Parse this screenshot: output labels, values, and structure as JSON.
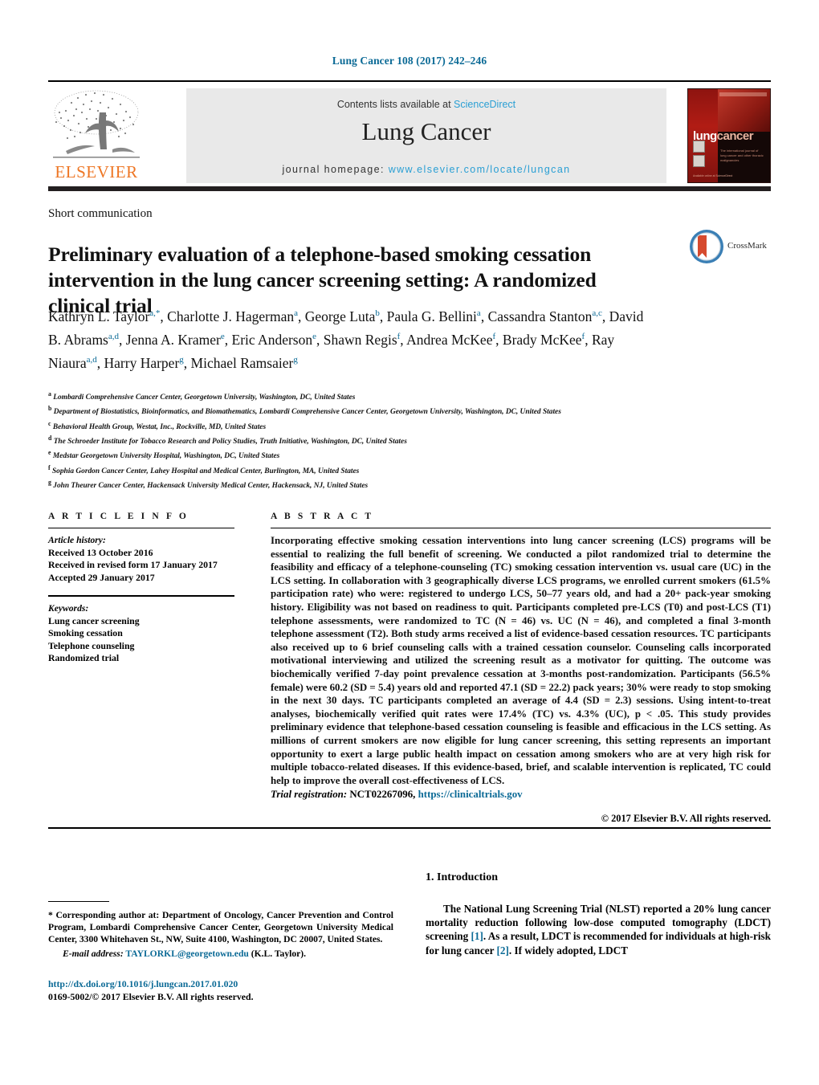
{
  "running_head": "Lung Cancer 108 (2017) 242–246",
  "masthead": {
    "contents_prefix": "Contents lists available at ",
    "contents_link": "ScienceDirect",
    "journal_title": "Lung Cancer",
    "homepage_prefix": "journal homepage: ",
    "homepage_url": "www.elsevier.com/locate/lungcan",
    "publisher_wordmark": "ELSEVIER",
    "cover": {
      "logo_part1": "lung",
      "logo_part2": "cancer",
      "subtitle": "The international journal of lung cancer and other thoracic malignancies",
      "footer": "Available online at ScienceDirect"
    },
    "colors": {
      "link": "#2a9fd4",
      "elsevier_orange": "#ee7624",
      "banner_gray": "#e9e9e9"
    }
  },
  "article": {
    "type": "Short communication",
    "title": "Preliminary evaluation of a telephone-based smoking cessation intervention in the lung cancer screening setting: A randomized clinical trial",
    "crossmark_label": "CrossMark",
    "authors_html": "Kathryn L. Taylor<sup>a,*</sup>, Charlotte J. Hagerman<sup>a</sup>, George Luta<sup>b</sup>, Paula G. Bellini<sup>a</sup>, Cassandra Stanton<sup>a,c</sup>, David B. Abrams<sup>a,d</sup>, Jenna A. Kramer<sup>e</sup>, Eric Anderson<sup>e</sup>, Shawn Regis<sup>f</sup>, Andrea McKee<sup>f</sup>, Brady McKee<sup>f</sup>, Ray Niaura<sup>a,d</sup>, Harry Harper<sup>g</sup>, Michael Ramsaier<sup>g</sup>",
    "affiliations": [
      {
        "marker": "a",
        "text": "Lombardi Comprehensive Cancer Center, Georgetown University, Washington, DC, United States"
      },
      {
        "marker": "b",
        "text": "Department of Biostatistics, Bioinformatics, and Biomathematics, Lombardi Comprehensive Cancer Center, Georgetown University, Washington, DC, United States"
      },
      {
        "marker": "c",
        "text": "Behavioral Health Group, Westat, Inc., Rockville, MD, United States"
      },
      {
        "marker": "d",
        "text": "The Schroeder Institute for Tobacco Research and Policy Studies, Truth Initiative, Washington, DC, United States"
      },
      {
        "marker": "e",
        "text": "Medstar Georgetown University Hospital, Washington, DC, United States"
      },
      {
        "marker": "f",
        "text": "Sophia Gordon Cancer Center, Lahey Hospital and Medical Center, Burlington, MA, United States"
      },
      {
        "marker": "g",
        "text": "John Theurer Cancer Center, Hackensack University Medical Center, Hackensack, NJ, United States"
      }
    ]
  },
  "article_info": {
    "heading": "A R T I C L E    I N F O",
    "history_label": "Article history:",
    "history": [
      "Received 13 October 2016",
      "Received in revised form 17 January 2017",
      "Accepted 29 January 2017"
    ],
    "keywords_label": "Keywords:",
    "keywords": [
      "Lung cancer screening",
      "Smoking cessation",
      "Telephone counseling",
      "Randomized trial"
    ]
  },
  "abstract": {
    "heading": "A B S T R A C T",
    "body": "Incorporating effective smoking cessation interventions into lung cancer screening (LCS) programs will be essential to realizing the full benefit of screening. We conducted a pilot randomized trial to determine the feasibility and efficacy of a telephone-counseling (TC) smoking cessation intervention vs. usual care (UC) in the LCS setting. In collaboration with 3 geographically diverse LCS programs, we enrolled current smokers (61.5% participation rate) who were: registered to undergo LCS, 50–77 years old, and had a 20+ pack-year smoking history. Eligibility was not based on readiness to quit. Participants completed pre-LCS (T0) and post-LCS (T1) telephone assessments, were randomized to TC (N = 46) vs. UC (N = 46), and completed a final 3-month telephone assessment (T2). Both study arms received a list of evidence-based cessation resources. TC participants also received up to 6 brief counseling calls with a trained cessation counselor. Counseling calls incorporated motivational interviewing and utilized the screening result as a motivator for quitting. The outcome was biochemically verified 7-day point prevalence cessation at 3-months post-randomization. Participants (56.5% female) were 60.2 (SD = 5.4) years old and reported 47.1 (SD = 22.2) pack years; 30% were ready to stop smoking in the next 30 days. TC participants completed an average of 4.4 (SD = 2.3) sessions. Using intent-to-treat analyses, biochemically verified quit rates were 17.4% (TC) vs. 4.3% (UC), p < .05. This study provides preliminary evidence that telephone-based cessation counseling is feasible and efficacious in the LCS setting. As millions of current smokers are now eligible for lung cancer screening, this setting represents an important opportunity to exert a large public health impact on cessation among smokers who are at very high risk for multiple tobacco-related diseases. If this evidence-based, brief, and scalable intervention is replicated, TC could help to improve the overall cost-effectiveness of LCS.",
    "trial_label": "Trial registration:",
    "trial_value": "NCT02267096,",
    "trial_link": "https://clinicaltrials.gov",
    "copyright": "© 2017 Elsevier B.V. All rights reserved."
  },
  "footnote": {
    "corresponding": "* Corresponding author at: Department of Oncology, Cancer Prevention and Control Program, Lombardi Comprehensive Cancer Center, Georgetown University Medical Center, 3300 Whitehaven St., NW, Suite 4100, Washington, DC 20007, United States.",
    "email_label": "E-mail address:",
    "email_value": "TAYLORKL@georgetown.edu",
    "email_suffix": " (K.L. Taylor).",
    "doi": "http://dx.doi.org/10.1016/j.lungcan.2017.01.020",
    "issn_line": "0169-5002/© 2017 Elsevier B.V. All rights reserved."
  },
  "introduction": {
    "heading": "1.  Introduction",
    "paragraph_html": "The National Lung Screening Trial (NLST) reported a 20% lung cancer mortality reduction following low-dose computed tomography (LDCT) screening <span class=\"ref\">[1]</span>. As a result, LDCT is recommended for individuals at high-risk for lung cancer <span class=\"ref\">[2]</span>. If widely adopted, LDCT"
  }
}
